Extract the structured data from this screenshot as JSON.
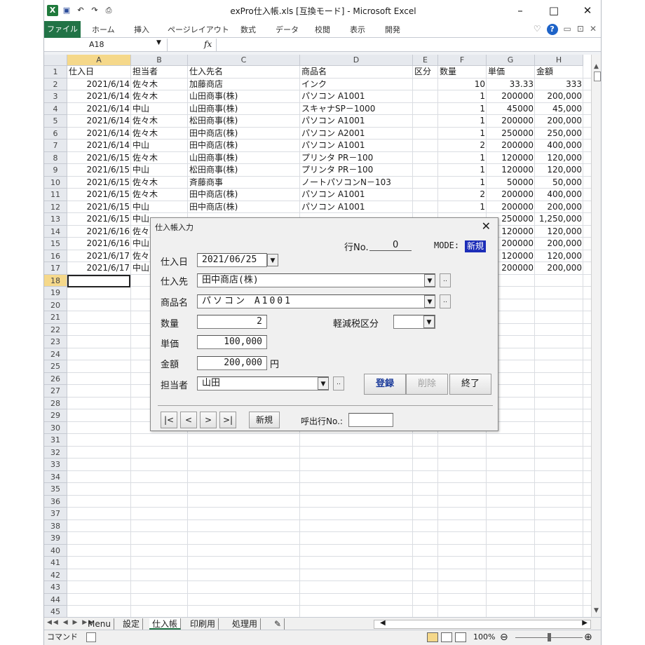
{
  "window": {
    "title": "exPro仕入帳.xls  [互換モード] - Microsoft Excel",
    "controls": {
      "minimize": "–",
      "maximize": "□",
      "close": "✕"
    }
  },
  "ribbon": {
    "tabs": [
      "ファイル",
      "ホーム",
      "挿入",
      "ページレイアウト",
      "数式",
      "データ",
      "校閲",
      "表示",
      "開発"
    ],
    "right_icons": [
      "♡",
      "?",
      "▭",
      "⊡",
      "✕"
    ]
  },
  "formula_bar": {
    "name_box": "A18",
    "fx": "fx",
    "content": ""
  },
  "grid": {
    "columns": [
      "A",
      "B",
      "C",
      "D",
      "E",
      "F",
      "G",
      "H"
    ],
    "selected_column": "A",
    "row_numbers": [
      "1",
      "2",
      "3",
      "4",
      "5",
      "6",
      "7",
      "8",
      "9",
      "10",
      "11",
      "12",
      "13",
      "14",
      "15",
      "16",
      "17",
      "18",
      "19",
      "20",
      "21",
      "22",
      "23",
      "24",
      "25",
      "26",
      "27",
      "28",
      "29",
      "30",
      "31",
      "32",
      "33",
      "34",
      "35",
      "36",
      "37",
      "38",
      "39",
      "40",
      "41",
      "42",
      "43",
      "44",
      "45"
    ],
    "selected_row": "18",
    "header": [
      "仕入日",
      "担当者",
      "仕入先名",
      "商品名",
      "区分",
      "数量",
      "単価",
      "金額"
    ],
    "rows": [
      [
        "2021/6/14",
        "佐々木",
        "加藤商店",
        "インク",
        "",
        "10",
        "33.33",
        "333"
      ],
      [
        "2021/6/14",
        "佐々木",
        "山田商事(株)",
        "パソコン A1001",
        "",
        "1",
        "200000",
        "200,000"
      ],
      [
        "2021/6/14",
        "中山",
        "山田商事(株)",
        "スキャナSP－1000",
        "",
        "1",
        "45000",
        "45,000"
      ],
      [
        "2021/6/14",
        "佐々木",
        "松田商事(株)",
        "パソコン A1001",
        "",
        "1",
        "200000",
        "200,000"
      ],
      [
        "2021/6/14",
        "佐々木",
        "田中商店(株)",
        "パソコン A2001",
        "",
        "1",
        "250000",
        "250,000"
      ],
      [
        "2021/6/14",
        "中山",
        "田中商店(株)",
        "パソコン A1001",
        "",
        "2",
        "200000",
        "400,000"
      ],
      [
        "2021/6/15",
        "佐々木",
        "山田商事(株)",
        "プリンタ PR－100",
        "",
        "1",
        "120000",
        "120,000"
      ],
      [
        "2021/6/15",
        "中山",
        "松田商事(株)",
        "プリンタ PR－100",
        "",
        "1",
        "120000",
        "120,000"
      ],
      [
        "2021/6/15",
        "佐々木",
        "斉藤商事",
        "ノートパソコンN－103",
        "",
        "1",
        "50000",
        "50,000"
      ],
      [
        "2021/6/15",
        "佐々木",
        "田中商店(株)",
        "パソコン A1001",
        "",
        "2",
        "200000",
        "400,000"
      ],
      [
        "2021/6/15",
        "中山",
        "田中商店(株)",
        "パソコン A1001",
        "",
        "1",
        "200000",
        "200,000"
      ],
      [
        "2021/6/15",
        "中山",
        "",
        "",
        "",
        "",
        "250000",
        "1,250,000"
      ],
      [
        "2021/6/16",
        "佐々",
        "",
        "",
        "",
        "",
        "120000",
        "120,000"
      ],
      [
        "2021/6/16",
        "中山",
        "",
        "",
        "",
        "",
        "200000",
        "200,000"
      ],
      [
        "2021/6/17",
        "佐々",
        "",
        "",
        "",
        "",
        "120000",
        "120,000"
      ],
      [
        "2021/6/17",
        "中山",
        "",
        "",
        "",
        "",
        "200000",
        "200,000"
      ]
    ]
  },
  "sheet_tabs": {
    "nav": "◀◀ ◀ ▶ ▶▶",
    "tabs": [
      "Menu",
      "設定",
      "仕入帳",
      "印刷用",
      "処理用"
    ],
    "active": "仕入帳"
  },
  "status_bar": {
    "mode": "コマンド",
    "zoom": "100%",
    "zoom_minus": "⊖",
    "zoom_plus": "⊕"
  },
  "dialog": {
    "title": "仕入帳入力",
    "close": "✕",
    "row_no_label": "行No.",
    "row_no_value": "0",
    "mode_label": "MODE:",
    "mode_value": "新規",
    "date_label": "仕入日",
    "date_value": "2021/06/25",
    "supplier_label": "仕入先",
    "supplier_value": "田中商店(株)",
    "product_label": "商品名",
    "product_value": "パソコン A1001",
    "qty_label": "数量",
    "qty_value": "2",
    "tax_label": "軽減税区分",
    "tax_value": "",
    "price_label": "単価",
    "price_value": "100,000",
    "amount_label": "金額",
    "amount_value": "200,000",
    "yen_label": "円",
    "staff_label": "担当者",
    "staff_value": "山田",
    "dots": "..",
    "register_button": "登録",
    "delete_button": "削除",
    "exit_button": "終了",
    "nav_first": "|<",
    "nav_prev": "<",
    "nav_next": ">",
    "nav_last": ">|",
    "new_button": "新規",
    "call_row_label": "呼出行No.:",
    "call_row_value": ""
  }
}
